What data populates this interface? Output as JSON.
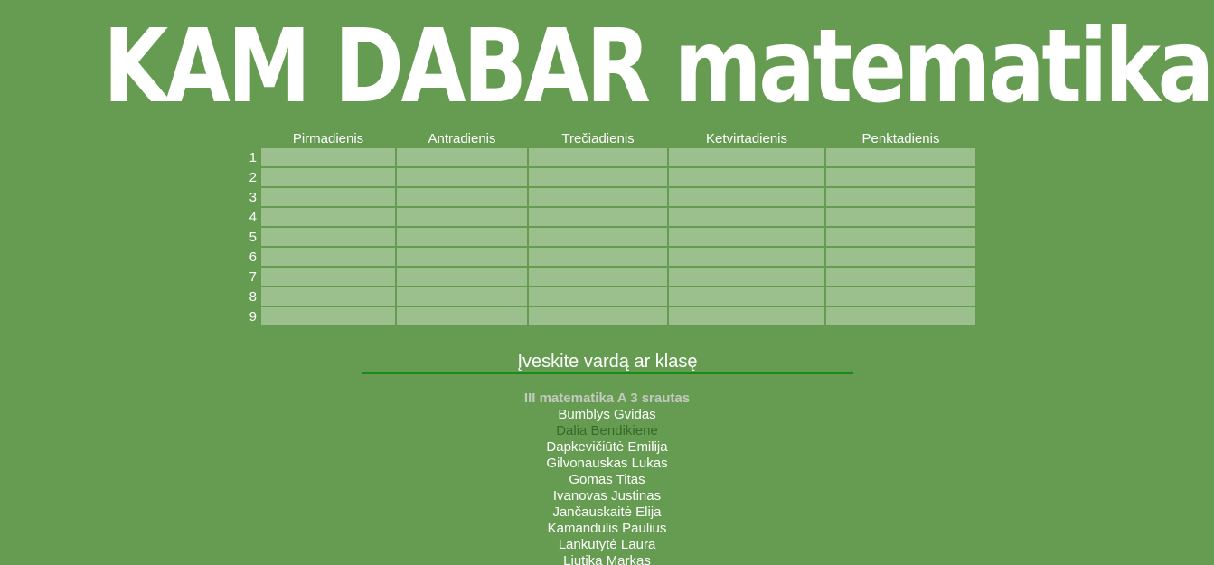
{
  "title": "KAM DABAR matematika?",
  "timetable": {
    "days": [
      "Pirmadienis",
      "Antradienis",
      "Trečiadienis",
      "Ketvirtadienis",
      "Penktadienis"
    ],
    "periods": [
      "1",
      "2",
      "3",
      "4",
      "5",
      "6",
      "7",
      "8",
      "9"
    ]
  },
  "search": {
    "placeholder": "Įveskite vardą ar klasę",
    "value": ""
  },
  "results": {
    "group_header": "III matematika A 3 srautas",
    "teacher": "Dalia Bendikienė",
    "items": [
      "Bumblys Gvidas",
      "Dalia Bendikienė",
      "Dapkevičiūtė Emilija",
      "Gilvonauskas Lukas",
      "Gomas Titas",
      "Ivanovas Justinas",
      "Jančauskaitė Elija",
      "Kamandulis Paulius",
      "Lankutytė Laura",
      "Liutika Markas"
    ]
  },
  "colors": {
    "background": "#669c52",
    "cell": "#9cc08d",
    "input_underline": "#1a8a1a",
    "group_header": "#c3c9bf",
    "teacher_text": "#356a28"
  }
}
